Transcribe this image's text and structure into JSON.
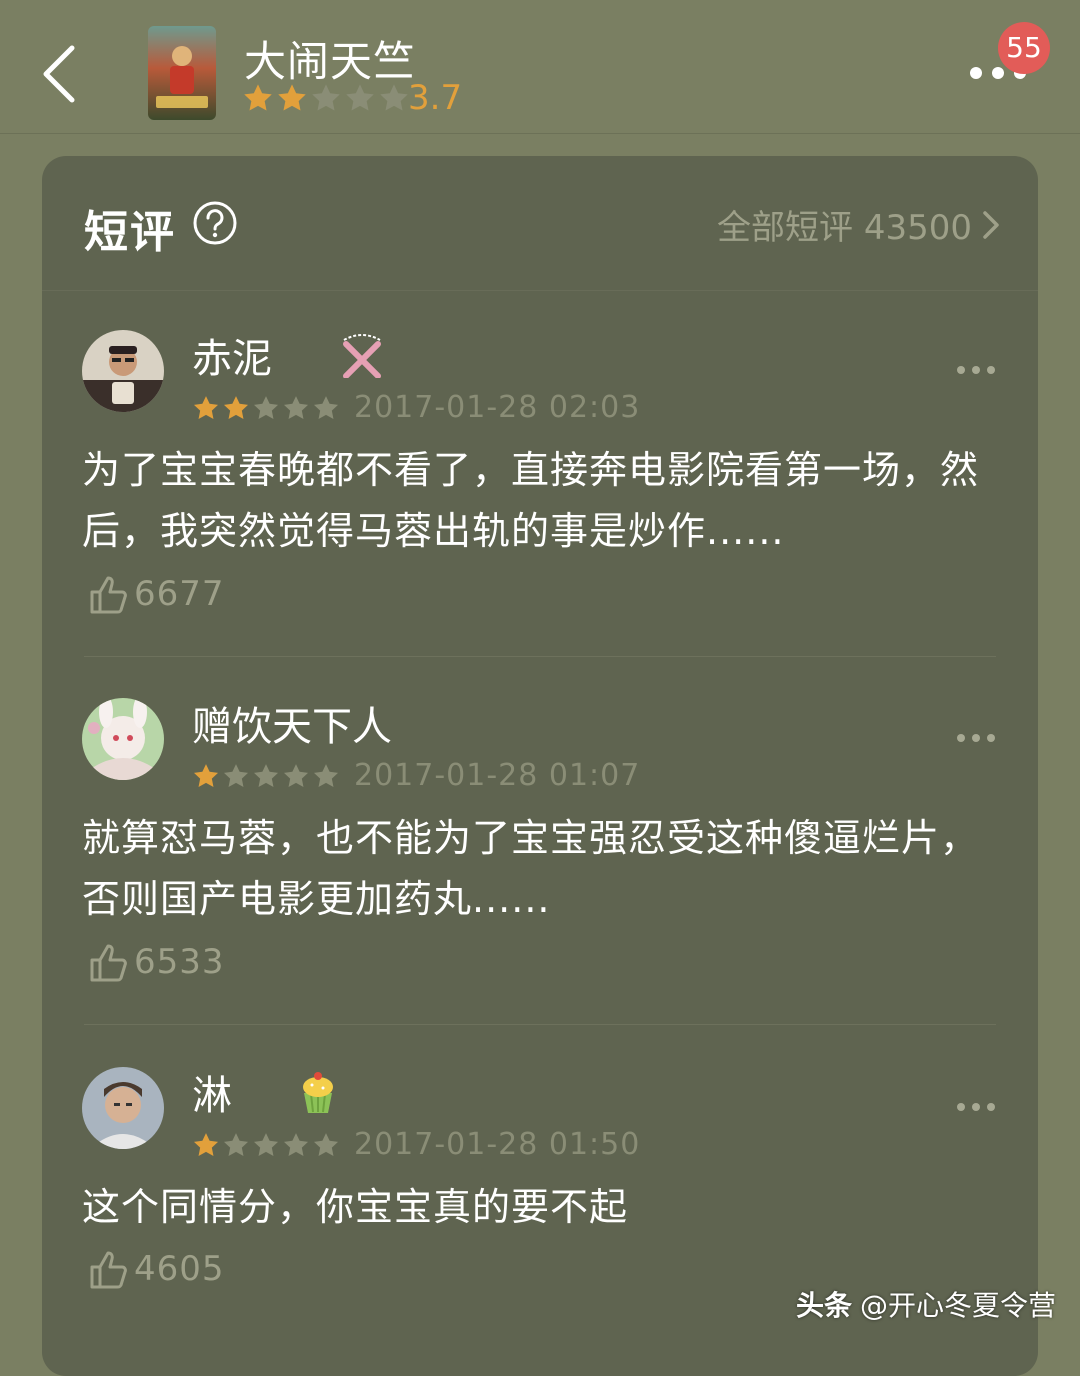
{
  "header": {
    "back_icon": "chevron-left-icon",
    "movie_title": "大闹天竺",
    "rating_stars": 2,
    "score": "3.7",
    "more_icon": "more-dots-icon",
    "notification_count": "55"
  },
  "section": {
    "title": "短评",
    "help_icon": "question-circle-icon",
    "all_reviews_label": "全部短评 43500",
    "all_reviews_icon": "chevron-right-icon"
  },
  "reviews": [
    {
      "username": "赤泥",
      "user_badge_icon": "crossed-nunchucks-icon",
      "stars": 2,
      "date": "2017-01-28 02:03",
      "text": "为了宝宝春晚都不看了，直接奔电影院看第一场，然后，我突然觉得马蓉出轨的事是炒作......",
      "likes": "6677"
    },
    {
      "username": "赠饮天下人",
      "user_badge_icon": "",
      "stars": 1,
      "date": "2017-01-28 01:07",
      "text": "就算怼马蓉，也不能为了宝宝强忍受这种傻逼烂片，否则国产电影更加药丸......",
      "likes": "6533"
    },
    {
      "username": "淋",
      "user_badge_icon": "cupcake-icon",
      "stars": 1,
      "date": "2017-01-28 01:50",
      "text": "这个同情分，你宝宝真的要不起",
      "likes": "4605"
    }
  ],
  "watermark": {
    "brand": "头条",
    "handle": "@开心冬夏令营"
  },
  "colors": {
    "background": "#7a7f62",
    "card": "#5f6450",
    "star_filled": "#e2a03b",
    "star_empty": "#8a8d76",
    "badge": "#e25c58"
  }
}
